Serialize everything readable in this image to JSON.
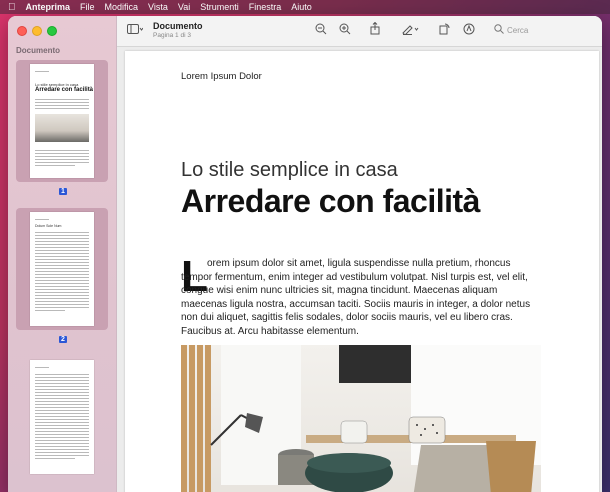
{
  "menubar": {
    "apple": "",
    "app": "Anteprima",
    "items": [
      "File",
      "Modifica",
      "Vista",
      "Vai",
      "Strumenti",
      "Finestra",
      "Aiuto"
    ]
  },
  "sidebar": {
    "title": "Documento",
    "pages": [
      {
        "label": "1",
        "heading_small": "Lo stile semplice in casa",
        "heading_big": "Arredare con facilità"
      },
      {
        "label": "2",
        "heading_small": "Dolum Sole Num"
      },
      {
        "label": "3"
      }
    ]
  },
  "toolbar": {
    "doc_title": "Documento",
    "doc_sub": "Pagina 1 di 3",
    "search_placeholder": "Cerca",
    "icons": [
      "sidebar-icon",
      "zoom-out-icon",
      "zoom-in-icon",
      "share-icon",
      "markup-pen-icon",
      "rotate-icon",
      "annotate-icon",
      "search-icon"
    ]
  },
  "page": {
    "header": "Lorem Ipsum Dolor",
    "subtitle": "Lo stile semplice in casa",
    "title": "Arredare con facilità",
    "dropcap": "L",
    "body": "orem ipsum dolor sit amet, ligula suspendisse nulla pretium, rhoncus tempor fermentum, enim integer ad vestibulum volutpat. Nisl turpis est, vel elit, congue wisi enim nunc ultricies sit, magna tincidunt. Maecenas aliquam maecenas ligula nostra, accumsan taciti. Sociis mauris in integer, a dolor netus non dui aliquet, sagittis felis sodales, dolor sociis mauris, vel eu libero cras. Faucibus at. Arcu habitasse elementum."
  },
  "colors": {
    "accent": "#2b57d6",
    "sidebar": "#e0c3cf"
  }
}
